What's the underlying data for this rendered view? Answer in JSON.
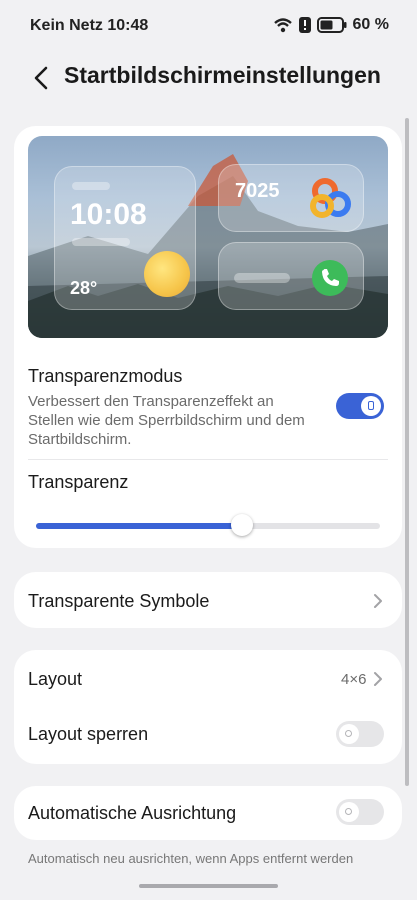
{
  "status": {
    "carrier_time": "Kein Netz 10:48",
    "battery": "60 %",
    "battery_level": 0.6
  },
  "header": {
    "title": "Startbildschirmeinstellungen"
  },
  "preview": {
    "time": "10:08",
    "temperature": "28°",
    "steps": "7025"
  },
  "transparency_mode": {
    "title": "Transparenzmodus",
    "description": "Verbessert den Transparenzeffekt an Stellen wie dem Sperrbildschirm und dem Startbildschirm.",
    "enabled": true
  },
  "transparency": {
    "title": "Transparenz",
    "level": 0.6
  },
  "transparent_icons": {
    "title": "Transparente Symbole"
  },
  "layout": {
    "title": "Layout",
    "value": "4×6"
  },
  "lock_layout": {
    "title": "Layout sperren",
    "enabled": false
  },
  "auto_align": {
    "title": "Automatische Ausrichtung",
    "enabled": false,
    "description": "Automatisch neu ausrichten, wenn Apps entfernt werden"
  },
  "colors": {
    "accent": "#3a63d6",
    "background": "#f1f1f3",
    "card": "#ffffff"
  }
}
